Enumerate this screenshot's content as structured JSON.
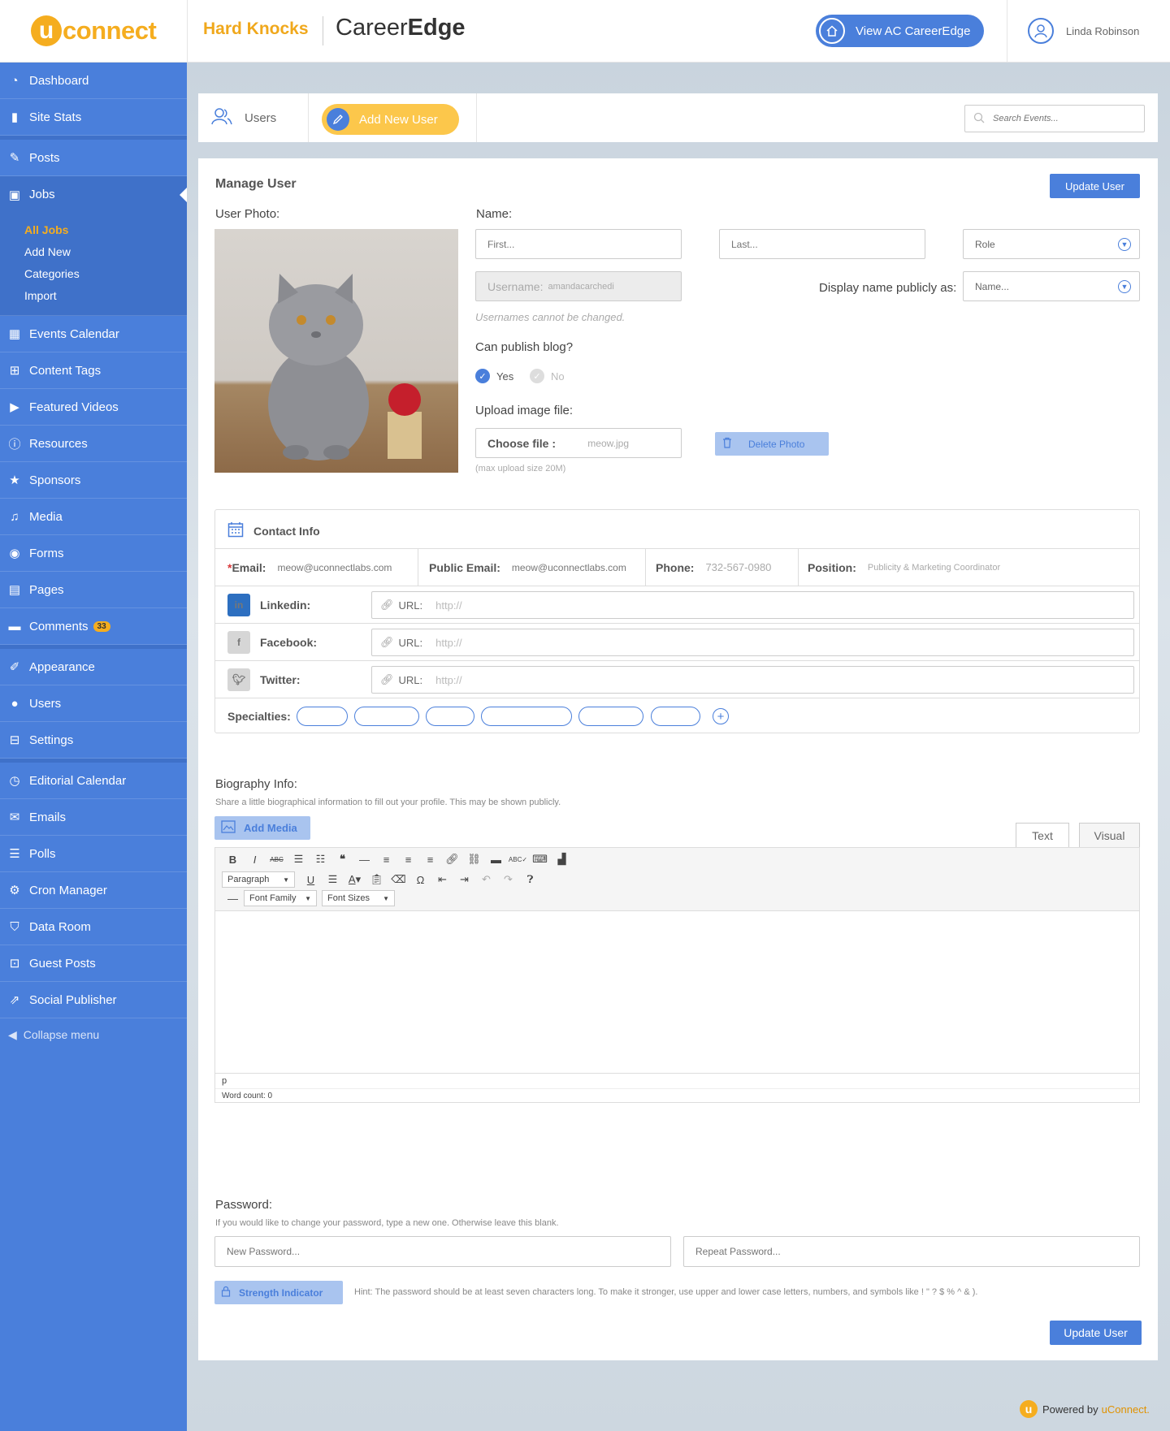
{
  "header": {
    "logo_u": "u",
    "logo_text": "connect",
    "brand_primary": "Hard Knocks",
    "brand_secondary_a": "Career",
    "brand_secondary_b": "Edge",
    "view_button": "View AC CareerEdge",
    "user_name": "Linda Robinson"
  },
  "sidebar": {
    "items": [
      {
        "label": "Dashboard",
        "icon": "dashboard-icon"
      },
      {
        "label": "Site Stats",
        "icon": "bar-chart-icon"
      },
      {
        "label": "Posts",
        "icon": "edit-icon"
      },
      {
        "label": "Jobs",
        "icon": "briefcase-icon"
      },
      {
        "label": "Events Calendar",
        "icon": "calendar-icon"
      },
      {
        "label": "Content Tags",
        "icon": "sitemap-icon"
      },
      {
        "label": "Featured Videos",
        "icon": "video-icon"
      },
      {
        "label": "Resources",
        "icon": "info-icon"
      },
      {
        "label": "Sponsors",
        "icon": "star-icon"
      },
      {
        "label": "Media",
        "icon": "media-icon"
      },
      {
        "label": "Forms",
        "icon": "forms-icon"
      },
      {
        "label": "Pages",
        "icon": "pages-icon"
      },
      {
        "label": "Comments",
        "icon": "comment-icon",
        "badge": "33"
      },
      {
        "label": "Appearance",
        "icon": "brush-icon"
      },
      {
        "label": "Users",
        "icon": "user-icon"
      },
      {
        "label": "Settings",
        "icon": "settings-icon"
      },
      {
        "label": "Editorial Calendar",
        "icon": "history-icon"
      },
      {
        "label": "Emails",
        "icon": "mail-icon"
      },
      {
        "label": "Polls",
        "icon": "list-icon"
      },
      {
        "label": "Cron Manager",
        "icon": "gear-icon"
      },
      {
        "label": "Data Room",
        "icon": "data-icon"
      },
      {
        "label": "Guest Posts",
        "icon": "guest-icon"
      },
      {
        "label": "Social Publisher",
        "icon": "share-icon"
      }
    ],
    "jobs_sub": [
      "All Jobs",
      "Add New",
      "Categories",
      "Import"
    ],
    "collapse": "Collapse menu"
  },
  "tabs": {
    "users": "Users",
    "add_new": "Add New User",
    "search_placeholder": "Search Events..."
  },
  "manage": {
    "title": "Manage User",
    "update_button": "Update User",
    "photo_label": "User Photo:",
    "name_label": "Name:",
    "first_placeholder": "First...",
    "last_placeholder": "Last...",
    "role_value": "Role",
    "username_label": "Username:",
    "username_value": "amandacarchedi",
    "username_note": "Usernames cannot be changed.",
    "display_label": "Display name publicly as:",
    "display_value": "Name...",
    "publish_label": "Can publish blog?",
    "yes": "Yes",
    "no": "No",
    "upload_label": "Upload image file:",
    "choose_file": "Choose file :",
    "file_name": "meow.jpg",
    "delete_photo": "Delete Photo",
    "max_upload": "(max upload size 20M)"
  },
  "contact": {
    "title": "Contact Info",
    "email_star": "*",
    "email_label": "Email:",
    "email_value": "meow@uconnectlabs.com",
    "public_email_label": "Public Email:",
    "public_email_value": "meow@uconnectlabs.com",
    "phone_label": "Phone:",
    "phone_value": "732-567-0980",
    "position_label": "Position:",
    "position_value": "Publicity & Marketing Coordinator",
    "social": [
      {
        "label": "Linkedin:",
        "url_label": "URL:",
        "placeholder": "http://"
      },
      {
        "label": "Facebook:",
        "url_label": "URL:",
        "placeholder": "http://"
      },
      {
        "label": "Twitter:",
        "url_label": "URL:",
        "placeholder": "http://"
      }
    ],
    "specialties_label": "Specialties:"
  },
  "bio": {
    "label": "Biography Info:",
    "hint": "Share a little biographical information to fill out your profile. This may be shown publicly.",
    "add_media": "Add Media",
    "tab_text": "Text",
    "tab_visual": "Visual",
    "paragraph": "Paragraph",
    "font_family": "Font Family",
    "font_sizes": "Font Sizes",
    "path": "p",
    "word_count": "Word count: 0"
  },
  "password": {
    "label": "Password:",
    "hint": "If you would like to change your password, type a new one. Otherwise leave this blank.",
    "new_placeholder": "New Password...",
    "repeat_placeholder": "Repeat Password...",
    "strength": "Strength Indicator",
    "strength_hint": "Hint: The password should be at least seven characters long. To make it stronger, use upper and lower case letters, numbers, and symbols like ! \" ? $ % ^ & ).",
    "update_button": "Update User"
  },
  "footer": {
    "powered_u": "u",
    "powered_by": "Powered by",
    "powered_brand": "uConnect."
  },
  "colors": {
    "primary": "#4a7fdb",
    "accent": "#f5ad1f"
  }
}
